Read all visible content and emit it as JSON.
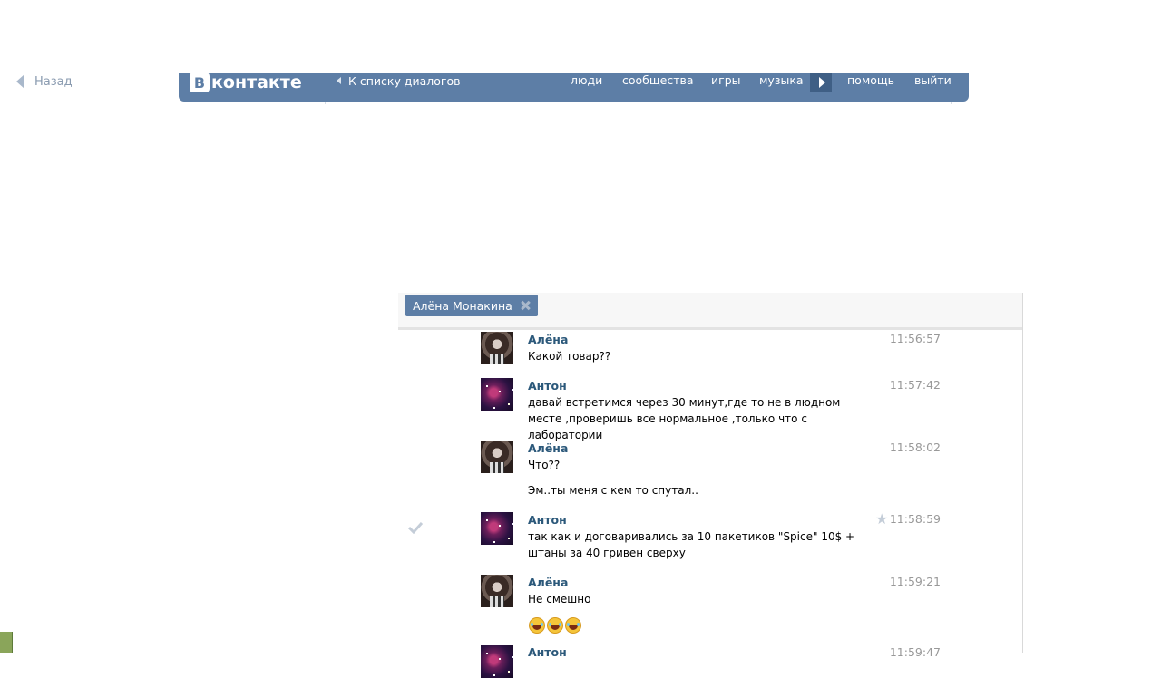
{
  "back": {
    "label": "Назад"
  },
  "topbar": {
    "logo_letter": "В",
    "logo_word": "контакте",
    "back_to_dialogs": "К списку диалогов",
    "nav": [
      "люди",
      "сообщества",
      "игры",
      "музыка",
      "помощь",
      "выйти"
    ],
    "bar_color": "#5d7ea6"
  },
  "chat": {
    "tab_label": "Алёна Монакина",
    "messages": [
      {
        "author": "Алёна",
        "time": "11:56:57",
        "text": "Какой товар??"
      },
      {
        "author": "Антон",
        "time": "11:57:42",
        "text": "давай встретимся через 30 минут,где то не в людном месте ,проверишь все нормальное ,только что с лаборатории"
      },
      {
        "author": "Алёна",
        "time": "11:58:02",
        "text": "Что??"
      },
      {
        "author": "",
        "time": "",
        "text": "Эм..ты меня с кем то спутал.."
      },
      {
        "author": "Антон",
        "time": "11:58:59",
        "text": "так как и договаривались за 10 пакетиков \"Spice\" 10$ + штаны за 40 гривен сверху"
      },
      {
        "author": "Алёна",
        "time": "11:59:21",
        "text": "Не смешно"
      },
      {
        "author": "Антон",
        "time": "11:59:47",
        "text": ""
      }
    ],
    "emoji": "laughing-face x3"
  }
}
